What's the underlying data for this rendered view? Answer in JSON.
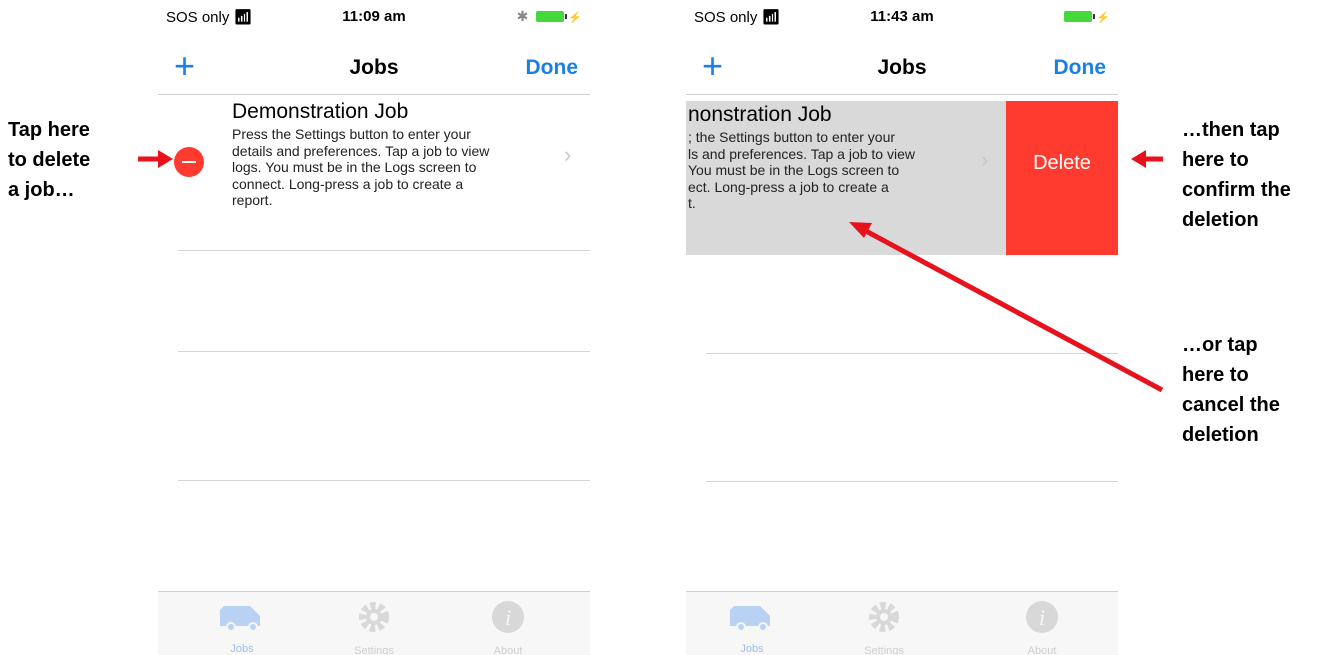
{
  "annotations": {
    "left": [
      "Tap here",
      "to delete",
      "a job…"
    ],
    "right_top": [
      "…then tap",
      "here to",
      "confirm the",
      "deletion"
    ],
    "right_bottom": [
      "…or tap",
      "here to",
      "cancel the",
      "deletion"
    ]
  },
  "colors": {
    "accent": "#1a7fe8",
    "delete": "#ff3b30",
    "arrow": "#e8121c"
  },
  "left_screen": {
    "status": {
      "carrier": "SOS only",
      "time": "11:09 am"
    },
    "nav": {
      "add": "+",
      "title": "Jobs",
      "done": "Done"
    },
    "job": {
      "title": "Demonstration Job",
      "lines": [
        "Press the Settings button to enter your",
        "details and preferences. Tap a job to view",
        "logs. You must be in the Logs screen to",
        "connect. Long-press a job to create a",
        "report."
      ]
    },
    "tabs": [
      "Jobs",
      "Settings",
      "About"
    ]
  },
  "right_screen": {
    "status": {
      "carrier": "SOS only",
      "time": "11:43 am"
    },
    "nav": {
      "add": "+",
      "title": "Jobs",
      "done": "Done"
    },
    "job": {
      "title": "nonstration Job",
      "lines": [
        "; the Settings button to enter your",
        "ls and preferences. Tap a job to view",
        "You must be in the Logs screen to",
        "ect. Long-press a job to create a",
        "t."
      ],
      "delete_label": "Delete"
    },
    "tabs": [
      "Jobs",
      "Settings",
      "About"
    ]
  }
}
